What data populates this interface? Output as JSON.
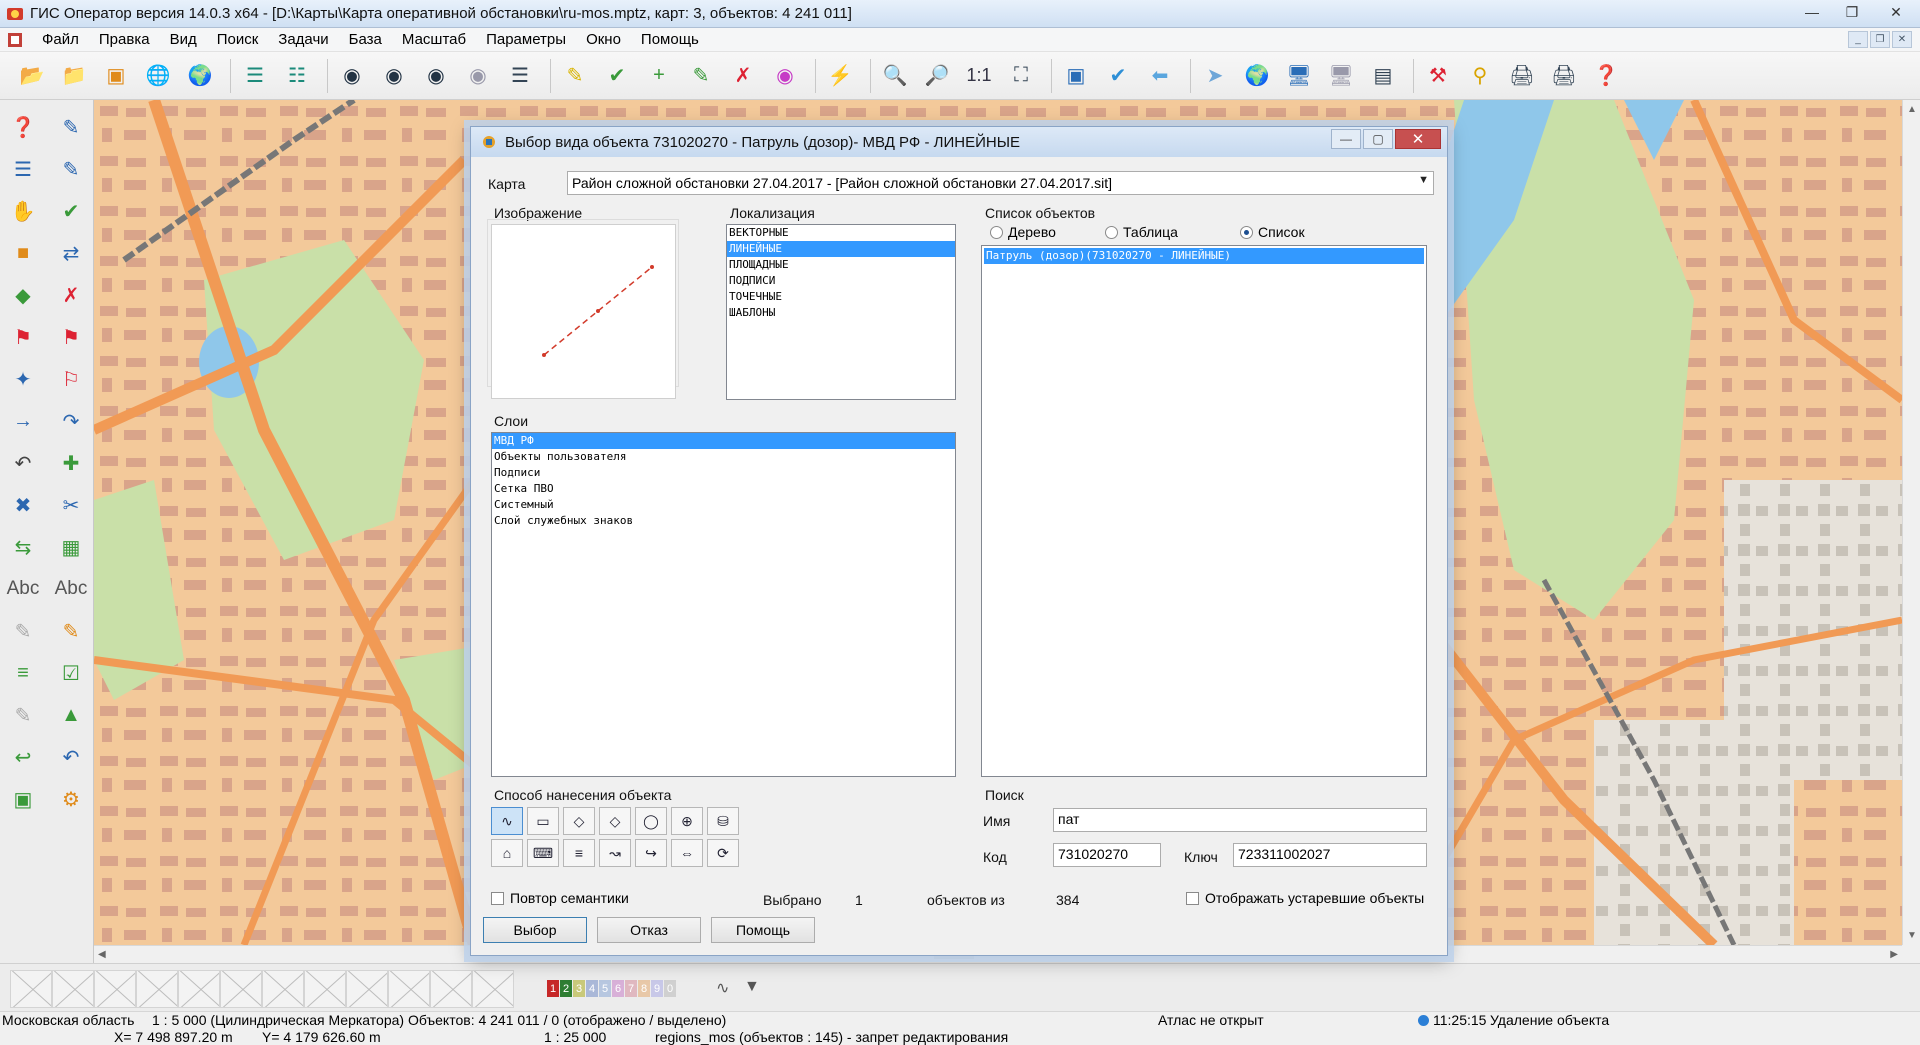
{
  "window": {
    "title": "ГИС Оператор версия 14.0.3 x64 - [D:\\Карты\\Карта оперативной обстановки\\ru-mos.mptz, карт: 3, объектов: 4 241 011]"
  },
  "menu": [
    "Файл",
    "Правка",
    "Вид",
    "Поиск",
    "Задачи",
    "База",
    "Масштаб",
    "Параметры",
    "Окно",
    "Помощь"
  ],
  "toolbar": {
    "scale_label": "1:1"
  },
  "left_tools": {
    "text_tool_1": "Abc",
    "text_tool_2": "Abc"
  },
  "dialog": {
    "title": "Выбор вида объекта 731020270 - Патруль (дозор)- МВД РФ - ЛИНЕЙНЫЕ",
    "map_label": "Карта",
    "map_value": "Район сложной обстановки 27.04.2017 - [Район сложной обстановки 27.04.2017.sit]",
    "image_label": "Изображение",
    "localization_label": "Локализация",
    "localization_items": [
      "ВЕКТОРНЫЕ",
      "ЛИНЕЙНЫЕ",
      "ПЛОЩАДНЫЕ",
      "ПОДПИСИ",
      "ТОЧЕЧНЫЕ",
      "ШАБЛОНЫ"
    ],
    "layers_label": "Слои",
    "layers_items": [
      "МВД РФ",
      "Объекты пользователя",
      "Подписи",
      "Сетка ПВО",
      "Системный",
      "Слой служебных знаков"
    ],
    "objects_label": "Список объектов",
    "view_modes": {
      "tree": "Дерево",
      "table": "Таблица",
      "list": "Список"
    },
    "objects_items": [
      "Патруль (дозор)(731020270 - ЛИНЕЙНЫЕ)"
    ],
    "draw_method_label": "Способ нанесения объекта",
    "search_label": "Поиск",
    "name_label": "Имя",
    "name_value": "пат",
    "code_label": "Код",
    "code_value": "731020270",
    "key_label": "Ключ",
    "key_value": "723311002027",
    "repeat_semantics_label": "Повтор семантики",
    "selected_label": "Выбрано",
    "selected_value": "1",
    "objects_of_label": "объектов из",
    "objects_total": "384",
    "show_obsolete_label": "Отображать устаревшие объекты",
    "btn_select": "Выбор",
    "btn_cancel": "Отказ",
    "btn_help": "Помощь"
  },
  "layer_strip": {
    "numbers": [
      "1",
      "2",
      "3",
      "4",
      "5",
      "6",
      "7",
      "8",
      "9",
      "0"
    ]
  },
  "status": {
    "region": "Московская область",
    "scale_info": "1 : 5 000 (Цилиндрическая Меркатора) Объектов: 4 241 011 / 0 (отображено / выделено)",
    "atlas": "Атлас не открыт",
    "time": "11:25:15",
    "last_action": "Удаление объекта",
    "x_coord": "X= 7 498 897.20 m",
    "y_coord": "Y= 4 179 626.60 m",
    "scale2": "1 : 25 000",
    "regions": "regions_mos   (объектов : 145) - запрет редактирования"
  },
  "colors": {
    "selection": "#3399ff",
    "map_background": "#f4ead8",
    "water": "#8fc7ea",
    "park": "#c9e0a8",
    "road": "#f19a55",
    "residential": "#f3c99a",
    "building": "#d9a48a"
  }
}
